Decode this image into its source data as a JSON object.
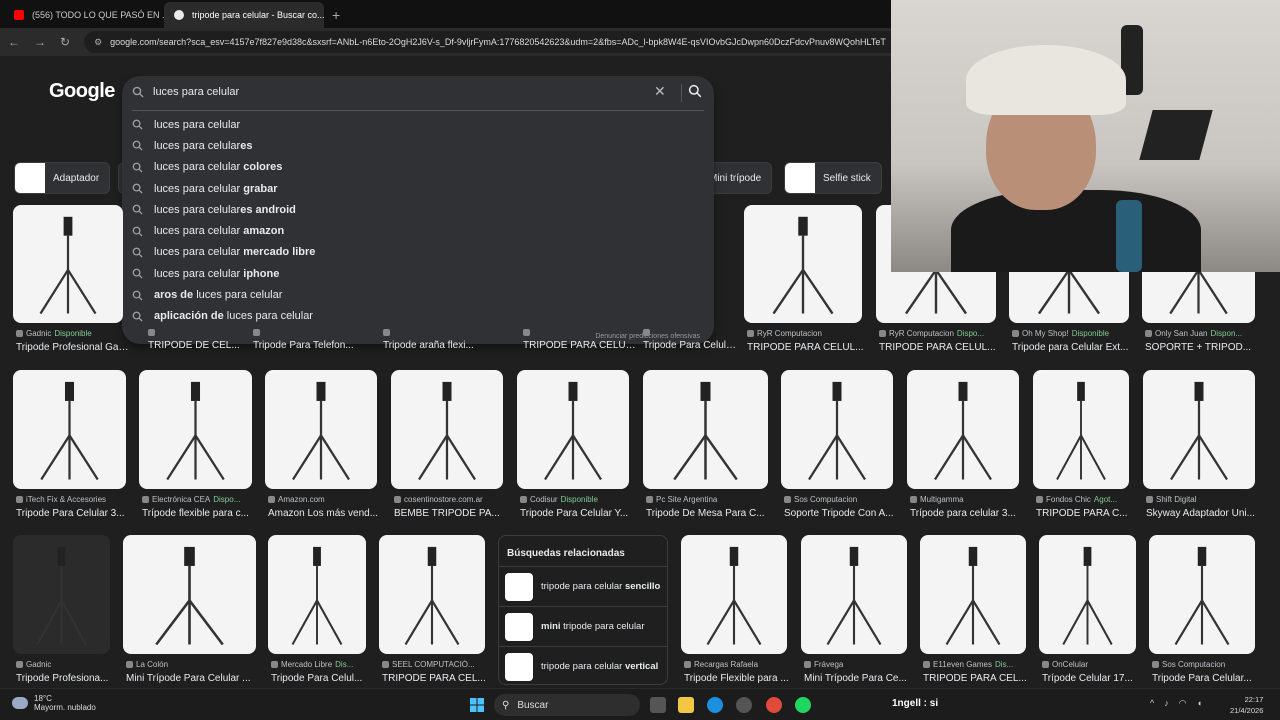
{
  "browser": {
    "tabs": [
      {
        "title": "(556) TODO LO QUE PASÓ EN ...",
        "close": "×",
        "color": "#ff0000"
      },
      {
        "title": "tripode para celular - Buscar co...",
        "close": "×",
        "color": "#e8eaed"
      }
    ],
    "new_tab": "+",
    "url": "google.com/search?sca_esv=4157e7f827e9d38c&sxsrf=ANbL-n6Eto-2OgH2J6V-s_Df-9vljrFymA:1776820542623&udm=2&fbs=ADc_l-bpk8W4E-qsVIOvbGJcDwpn60DczFdcvPnuv8WQohHLTeT"
  },
  "google": {
    "logo": "Google",
    "query": "luces para celular",
    "suggestions": [
      {
        "pre": "luces para celular",
        "bold": "",
        "post": ""
      },
      {
        "pre": "luces para celular",
        "bold": "es",
        "post": ""
      },
      {
        "pre": "luces para celular ",
        "bold": "colores",
        "post": ""
      },
      {
        "pre": "luces para celular ",
        "bold": "grabar",
        "post": ""
      },
      {
        "pre": "luces para celular",
        "bold": "es android",
        "post": ""
      },
      {
        "pre": "luces para celular ",
        "bold": "amazon",
        "post": ""
      },
      {
        "pre": "luces para celular ",
        "bold": "mercado libre",
        "post": ""
      },
      {
        "pre": "luces para celular ",
        "bold": "iphone",
        "post": ""
      },
      {
        "pre": "",
        "bold": "aros de",
        "post": " luces para celular"
      },
      {
        "pre": "",
        "bold": "aplicación de",
        "post": " luces para celular"
      }
    ],
    "report": "Denunciar predicciones ofensivas",
    "chips": [
      "Adaptador",
      "Mini trípode",
      "Selfie stick"
    ]
  },
  "results": {
    "row1": [
      {
        "source": "Gadnic",
        "avail": "Disponible",
        "title": "Tripode Profesional Gad..."
      },
      {
        "source": "",
        "avail": "",
        "title": "TRIPODE DE CEL..."
      },
      {
        "source": "",
        "avail": "",
        "title": "Tripode Para Telefon..."
      },
      {
        "source": "",
        "avail": "",
        "title": "Tripode araña flexi..."
      },
      {
        "source": "",
        "avail": "",
        "title": "TRIPODE PARA CELULA..."
      },
      {
        "source": "",
        "avail": "",
        "title": "Tripode Para Celular ..."
      },
      {
        "source": "RyR Computacion",
        "avail": "",
        "title": "TRIPODE PARA CELUL..."
      },
      {
        "source": "RyR Computacion",
        "avail": "Dispo...",
        "title": "TRIPODE PARA CELUL..."
      },
      {
        "source": "Oh My Shop!",
        "avail": "Disponible",
        "title": "Tripode para Celular Ext..."
      },
      {
        "source": "Only San Juan",
        "avail": "Dispon...",
        "title": "SOPORTE + TRIPOD..."
      }
    ],
    "row2": [
      {
        "source": "iTech Fix & Accesories",
        "avail": "",
        "title": "Tripode Para Celular 3..."
      },
      {
        "source": "Electrónica CEA",
        "avail": "Dispo...",
        "title": "Trípode flexible para c..."
      },
      {
        "source": "Amazon.com",
        "avail": "",
        "title": "Amazon Los más vend..."
      },
      {
        "source": "cosentinostore.com.ar",
        "avail": "",
        "title": "BEMBE TRIPODE PA..."
      },
      {
        "source": "Codisur",
        "avail": "Disponible",
        "title": "Tripode Para Celular Y..."
      },
      {
        "source": "Pc Site Argentina",
        "avail": "",
        "title": "Tripode De Mesa Para C..."
      },
      {
        "source": "Sos Computacion",
        "avail": "",
        "title": "Soporte Tripode Con A..."
      },
      {
        "source": "Multigamma",
        "avail": "",
        "title": "Trípode para celular 3..."
      },
      {
        "source": "Fondos Chic",
        "avail": "Agot...",
        "title": "TRIPODE PARA C..."
      },
      {
        "source": "Shift Digital",
        "avail": "",
        "title": "Skyway Adaptador Uni..."
      }
    ],
    "row3": [
      {
        "source": "Gadnic",
        "avail": "",
        "title": "Tripode Profesiona..."
      },
      {
        "source": "La Colón",
        "avail": "",
        "title": "Mini Trípode Para Celular ..."
      },
      {
        "source": "Mercado Libre",
        "avail": "Dis...",
        "title": "Tripode Para Celul..."
      },
      {
        "source": "SEEL COMPUTACIÓ...",
        "avail": "",
        "title": "TRIPODE PARA CEL..."
      },
      {
        "source": "Recargas Rafaela",
        "avail": "",
        "title": "Tripode Flexible para ..."
      },
      {
        "source": "Frávega",
        "avail": "",
        "title": "Mini Trípode Para Ce..."
      },
      {
        "source": "E11even Games",
        "avail": "Dis...",
        "title": "TRIPODE PARA CEL..."
      },
      {
        "source": "OnCelular",
        "avail": "",
        "title": "Trípode Celular 17..."
      },
      {
        "source": "Sos Computacion",
        "avail": "",
        "title": "Tripode Para Celular..."
      }
    ],
    "related": {
      "heading": "Búsquedas relacionadas",
      "items": [
        {
          "pre": "tripode para celular ",
          "bold": "sencillo",
          "post": ""
        },
        {
          "pre": "",
          "bold": "mini",
          "post": " tripode para celular"
        },
        {
          "pre": "tripode para celular ",
          "bold": "vertical",
          "post": ""
        }
      ]
    }
  },
  "taskbar": {
    "temp": "18°C",
    "weather": "Mayorm. nublado",
    "search": "Buscar",
    "status": "1ngell : si",
    "time": "22:17",
    "date": "21/4/2026"
  }
}
